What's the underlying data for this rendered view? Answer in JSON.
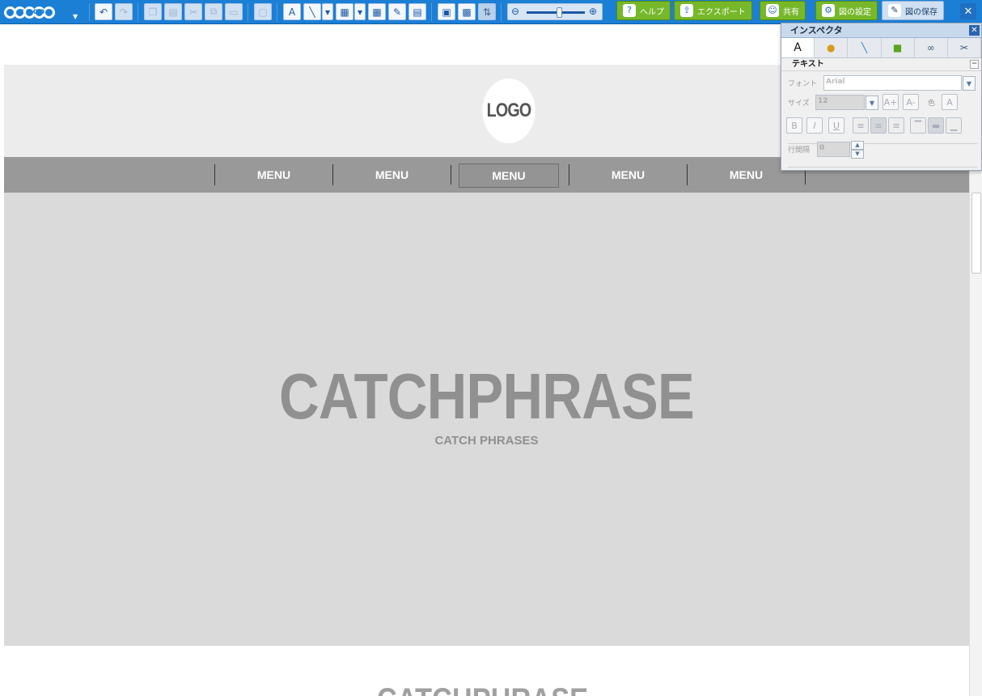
{
  "toolbar": {
    "logo_text": "cacoo",
    "help_label": "ヘルプ",
    "export_label": "エクスポート",
    "share_label": "共有",
    "settings_label": "図の設定",
    "save_label": "図の保存",
    "close_label": "✕",
    "icons": [
      "undo-icon",
      "redo-icon",
      "copy-icon",
      "paste-icon",
      "cut-icon",
      "duplicate-icon",
      "delete-icon",
      "group-icon",
      "text-icon",
      "line-icon",
      "shape-icon",
      "table-icon",
      "pen-icon",
      "note-icon",
      "stencil-icon",
      "image-icon",
      "align-icon",
      "zoom-out-icon",
      "zoom-in-icon"
    ]
  },
  "zoom": {
    "level": 0.55
  },
  "canvas": {
    "logo_text": "LOGO",
    "menu_items": [
      "MENU",
      "MENU",
      "MENU",
      "MENU",
      "MENU"
    ],
    "selected_menu_index": 2,
    "catchphrase": "CATCHPHRASE",
    "catchphrase_sub": "CATCH PHRASES",
    "catchphrase_repeat": "CATCHPHRASE"
  },
  "inspector": {
    "title": "インスペクタ",
    "tabs": [
      "A",
      "🥔",
      "╲",
      "▣",
      "🔗",
      "✂"
    ],
    "section_title": "テキスト",
    "font_label": "フォント",
    "font_value": "Arial",
    "size_label": "サイズ",
    "size_value": "12",
    "color_label": "色",
    "line_spacing_label": "行間隔",
    "line_spacing_value": "0",
    "bold_label": "B",
    "italic_label": "I",
    "underline_label": "U"
  }
}
